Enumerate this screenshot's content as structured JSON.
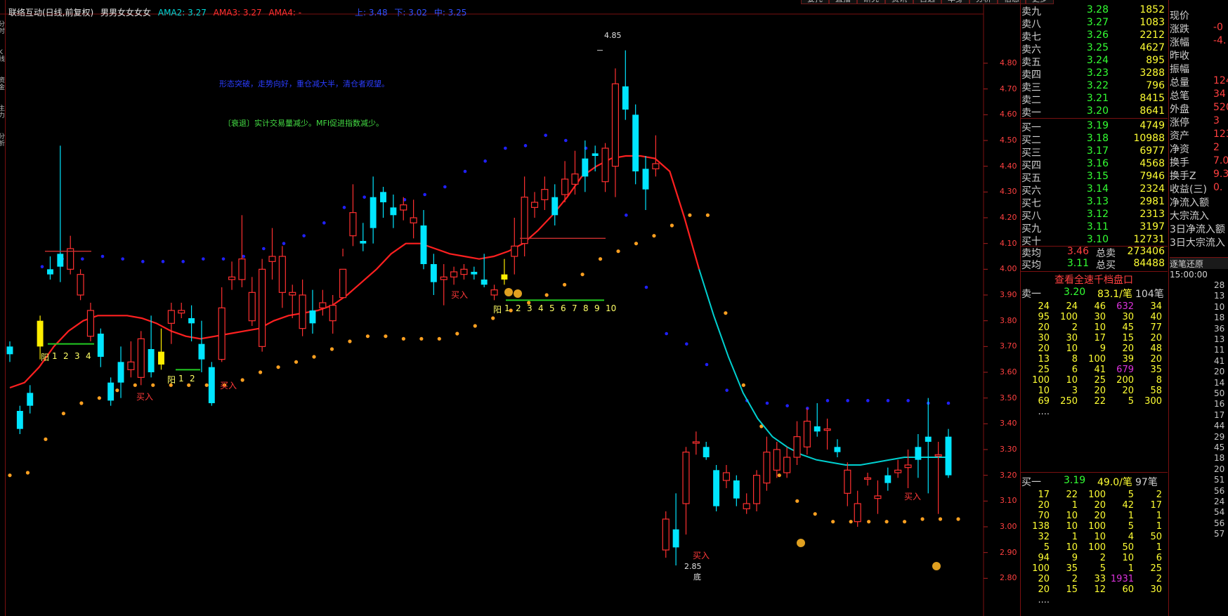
{
  "colors": {
    "up": "#ff3030",
    "down": "#00e5ff",
    "ma_red": "#ff2020",
    "ma_cyan": "#00d0d0",
    "dot_orange": "#ffa020",
    "dot_blue": "#2020ff",
    "yellow_bar": "#ffee00",
    "neutral": "#e0e0e0"
  },
  "menu": [
    "委托",
    "直播",
    "研究",
    "资讯",
    "自选",
    "本身",
    "分析",
    "信息",
    "更多"
  ],
  "header": {
    "stock_name": "联络互动(日线,前复权)",
    "indicator": "男男女女女女",
    "ama2": "AMA2: 3.27",
    "ama3": "AMA3: 3.27",
    "ama4": "AMA4: -",
    "up": "上: 3.48",
    "down": "下: 3.02",
    "mid": "中: 3.25"
  },
  "rail_labels": [
    "分时",
    "K线",
    "资金",
    "主力",
    "分析"
  ],
  "annotations": {
    "blue_text": "形态突破，走势向好，重仓减大半，清仓者观望。",
    "green_text": "〔衰退〕实计交易量减少。MFI促进指数减少。"
  },
  "price_axis": [
    "4.80",
    "4.70",
    "4.60",
    "4.50",
    "4.40",
    "4.30",
    "4.20",
    "4.10",
    "4.00",
    "3.90",
    "3.80",
    "3.70",
    "3.60",
    "3.50",
    "3.40",
    "3.30",
    "3.20",
    "3.10",
    "3.00",
    "2.90",
    "2.80"
  ],
  "chart_data": {
    "type": "candlestick",
    "ylim": [
      2.7,
      4.92
    ],
    "candles": [
      [
        3.7,
        3.67,
        3.72,
        3.64
      ],
      [
        3.45,
        3.38,
        3.47,
        3.36
      ],
      [
        3.52,
        3.47,
        3.55,
        3.44
      ],
      [
        3.8,
        3.7,
        3.82,
        3.65
      ],
      [
        4.0,
        3.98,
        4.05,
        3.96
      ],
      [
        4.06,
        4.01,
        4.48,
        3.95
      ],
      [
        4.0,
        4.08,
        4.13,
        3.98
      ],
      [
        3.9,
        3.98,
        4.0,
        3.88
      ],
      [
        3.74,
        3.84,
        3.87,
        3.72
      ],
      [
        3.75,
        3.66,
        3.77,
        3.62
      ],
      [
        3.56,
        3.49,
        3.58,
        3.47
      ],
      [
        3.64,
        3.56,
        3.7,
        3.5
      ],
      [
        3.61,
        3.64,
        3.72,
        3.58
      ],
      [
        3.58,
        3.73,
        3.76,
        3.55
      ],
      [
        3.69,
        3.6,
        3.82,
        3.58
      ],
      [
        3.68,
        3.63,
        3.77,
        3.61
      ],
      [
        3.79,
        3.84,
        3.87,
        3.71
      ],
      [
        3.83,
        3.84,
        3.87,
        3.81
      ],
      [
        3.81,
        3.79,
        3.86,
        3.72
      ],
      [
        3.71,
        3.65,
        3.8,
        3.6
      ],
      [
        3.62,
        3.48,
        3.64,
        3.47
      ],
      [
        3.65,
        3.85,
        3.93,
        3.64
      ],
      [
        3.96,
        3.97,
        4.03,
        3.92
      ],
      [
        3.96,
        4.04,
        4.21,
        3.93
      ],
      [
        3.8,
        3.91,
        3.97,
        3.78
      ],
      [
        3.7,
        4.0,
        4.04,
        3.68
      ],
      [
        4.03,
        4.05,
        4.16,
        3.96
      ],
      [
        3.91,
        4.05,
        4.09,
        3.85
      ],
      [
        3.9,
        3.91,
        3.94,
        3.81
      ],
      [
        3.77,
        3.9,
        3.96,
        3.74
      ],
      [
        3.84,
        3.79,
        3.92,
        3.75
      ],
      [
        3.85,
        3.87,
        3.92,
        3.82
      ],
      [
        3.8,
        3.86,
        3.9,
        3.75
      ],
      [
        3.89,
        4.0,
        4.08,
        4.05
      ],
      [
        4.13,
        4.22,
        4.33,
        4.09
      ],
      [
        4.11,
        4.1,
        4.18,
        4.07
      ],
      [
        4.28,
        4.16,
        4.36,
        4.1
      ],
      [
        4.3,
        4.26,
        4.32,
        4.2
      ],
      [
        4.24,
        4.21,
        4.29,
        4.16
      ],
      [
        4.23,
        4.25,
        4.28,
        4.19
      ],
      [
        4.18,
        4.2,
        4.27,
        4.12
      ],
      [
        4.17,
        4.02,
        4.23,
        4.0
      ],
      [
        4.02,
        3.95,
        4.06,
        3.9
      ],
      [
        3.96,
        3.97,
        4.02,
        3.86
      ],
      [
        3.97,
        3.99,
        4.01,
        3.94
      ],
      [
        3.98,
        4.0,
        4.02,
        3.96
      ],
      [
        3.99,
        3.98,
        4.01,
        3.96
      ],
      [
        3.96,
        3.94,
        4.06,
        3.93
      ],
      [
        3.9,
        3.92,
        3.94,
        3.88
      ],
      [
        3.98,
        3.96,
        4.04,
        3.94
      ],
      [
        4.05,
        4.09,
        4.2,
        3.98
      ],
      [
        4.1,
        4.28,
        4.36,
        4.05
      ],
      [
        4.24,
        4.26,
        4.3,
        4.2
      ],
      [
        4.27,
        4.31,
        4.36,
        4.23
      ],
      [
        4.28,
        4.21,
        4.33,
        4.17
      ],
      [
        4.29,
        4.35,
        4.42,
        4.26
      ],
      [
        4.33,
        4.37,
        4.46,
        4.29
      ],
      [
        4.43,
        4.36,
        4.5,
        4.3
      ],
      [
        4.45,
        4.44,
        4.48,
        4.38
      ],
      [
        4.34,
        4.47,
        4.49,
        4.3
      ],
      [
        4.4,
        4.72,
        4.78,
        4.28
      ],
      [
        4.71,
        4.62,
        4.85,
        4.58
      ],
      [
        4.6,
        4.38,
        4.64,
        4.33
      ],
      [
        4.39,
        4.31,
        4.44,
        4.23
      ],
      [
        4.39,
        4.41,
        4.52,
        4.36
      ],
      [
        2.91,
        3.03,
        3.06,
        2.88
      ],
      [
        2.99,
        2.92,
        3.13,
        2.85
      ],
      [
        3.09,
        3.29,
        3.31,
        2.97
      ],
      [
        3.33,
        3.33,
        3.37,
        3.28
      ],
      [
        3.31,
        3.27,
        3.33,
        3.26
      ],
      [
        3.22,
        3.08,
        3.24,
        3.06
      ],
      [
        3.18,
        3.21,
        3.24,
        3.15
      ],
      [
        3.18,
        3.11,
        3.2,
        3.08
      ],
      [
        3.07,
        3.09,
        3.13,
        3.05
      ],
      [
        3.09,
        3.2,
        3.22,
        3.06
      ],
      [
        3.17,
        3.29,
        3.35,
        3.14
      ],
      [
        3.22,
        3.3,
        3.33,
        3.19
      ],
      [
        3.21,
        3.27,
        3.31,
        3.19
      ],
      [
        3.27,
        3.35,
        3.41,
        3.24
      ],
      [
        3.31,
        3.41,
        3.46,
        3.28
      ],
      [
        3.39,
        3.37,
        3.48,
        3.35
      ],
      [
        3.38,
        3.38,
        3.42,
        3.3
      ],
      [
        3.31,
        3.29,
        3.34,
        3.27
      ],
      [
        3.13,
        3.22,
        3.25,
        3.08
      ],
      [
        3.02,
        3.09,
        3.14,
        3.0
      ],
      [
        3.19,
        3.19,
        3.21,
        3.16
      ],
      [
        3.11,
        3.12,
        3.18,
        3.05
      ],
      [
        3.2,
        3.17,
        3.23,
        3.14
      ],
      [
        3.21,
        3.22,
        3.26,
        3.19
      ],
      [
        3.23,
        3.24,
        3.3,
        3.15
      ],
      [
        3.31,
        3.26,
        3.36,
        3.19
      ],
      [
        3.35,
        3.33,
        3.5,
        3.13
      ],
      [
        3.28,
        3.28,
        3.33,
        3.05
      ],
      [
        3.35,
        3.2,
        3.38,
        3.19
      ]
    ],
    "ma_red": [
      3.54,
      3.56,
      3.62,
      3.7,
      3.76,
      3.8,
      3.82,
      3.82,
      3.82,
      3.81,
      3.79,
      3.76,
      3.74,
      3.73,
      3.74,
      3.75,
      3.76,
      3.77,
      3.8,
      3.82,
      3.83,
      3.84,
      3.86,
      3.9,
      3.95,
      4.0,
      4.06,
      4.1,
      4.1,
      4.08,
      4.06,
      4.05,
      4.04,
      4.05,
      4.07,
      4.1,
      4.15,
      4.21,
      4.28,
      4.36,
      4.4,
      4.43,
      4.44,
      4.44,
      4.43,
      4.38,
      4.2,
      4.0,
      3.82,
      3.66,
      3.52,
      3.42,
      3.35,
      3.31,
      3.28,
      3.26,
      3.25,
      3.24,
      3.24,
      3.25,
      3.26,
      3.27,
      3.27,
      3.27,
      3.27
    ],
    "ma_cyan_range": [
      47,
      64
    ],
    "up_dots": [
      3.2,
      3.21,
      3.34,
      3.44,
      3.48,
      3.5,
      3.53,
      3.55,
      3.55,
      3.55,
      3.55,
      3.55,
      3.55,
      3.57,
      3.6,
      3.62,
      3.64,
      3.66,
      3.69,
      3.72,
      3.74,
      3.74,
      3.73,
      3.73,
      3.73,
      3.75,
      3.78,
      3.81,
      3.84,
      3.87,
      3.9,
      3.94,
      3.98,
      4.04,
      4.07,
      4.1,
      4.13,
      4.17,
      4.21,
      4.21,
      3.83,
      3.55,
      3.39,
      3.2,
      3.1,
      3.05,
      3.02,
      3.02,
      3.02,
      3.02,
      3.02,
      3.03,
      3.03,
      3.03
    ],
    "down_dots": [
      4.01,
      4.04,
      4.04,
      4.05,
      4.04,
      4.03,
      4.03,
      4.03,
      4.04,
      4.04,
      4.05,
      4.08,
      4.1,
      4.13,
      4.18,
      4.24,
      4.28,
      4.28,
      4.27,
      4.29,
      4.32,
      4.38,
      4.42,
      4.47,
      4.48,
      4.52,
      4.5,
      4.47,
      4.4,
      4.21,
      3.93,
      3.75,
      3.71,
      3.63,
      3.53,
      3.49,
      3.48,
      3.47,
      3.46,
      3.49,
      3.49,
      3.49,
      3.49,
      3.49,
      3.48,
      3.48
    ],
    "labels": {
      "high": "4.85",
      "low": "2.85",
      "bottom": "底"
    }
  },
  "signals": {
    "buy": "买入",
    "yang": "阳"
  },
  "yang_seqs": [
    {
      "nums": [
        "1",
        "2",
        "3",
        "4"
      ]
    },
    {
      "nums": [
        "1",
        "2"
      ]
    },
    {
      "nums": [
        "1",
        "2",
        "3",
        "4",
        "5",
        "6",
        "7",
        "8",
        "9",
        "10"
      ]
    }
  ],
  "orderbook": {
    "asks": [
      {
        "label": "卖九",
        "price": "3.28",
        "vol": "1852"
      },
      {
        "label": "卖八",
        "price": "3.27",
        "vol": "1083"
      },
      {
        "label": "卖七",
        "price": "3.26",
        "vol": "2212"
      },
      {
        "label": "卖六",
        "price": "3.25",
        "vol": "4627"
      },
      {
        "label": "卖五",
        "price": "3.24",
        "vol": "895"
      },
      {
        "label": "卖四",
        "price": "3.23",
        "vol": "3288"
      },
      {
        "label": "卖三",
        "price": "3.22",
        "vol": "796"
      },
      {
        "label": "卖二",
        "price": "3.21",
        "vol": "8415"
      },
      {
        "label": "卖一",
        "price": "3.20",
        "vol": "8641"
      }
    ],
    "bids": [
      {
        "label": "买一",
        "price": "3.19",
        "vol": "4749"
      },
      {
        "label": "买二",
        "price": "3.18",
        "vol": "10988"
      },
      {
        "label": "买三",
        "price": "3.17",
        "vol": "6977"
      },
      {
        "label": "买四",
        "price": "3.16",
        "vol": "4568"
      },
      {
        "label": "买五",
        "price": "3.15",
        "vol": "7946"
      },
      {
        "label": "买六",
        "price": "3.14",
        "vol": "2324"
      },
      {
        "label": "买七",
        "price": "3.13",
        "vol": "2981"
      },
      {
        "label": "买八",
        "price": "3.12",
        "vol": "2313"
      },
      {
        "label": "买九",
        "price": "3.11",
        "vol": "3197"
      },
      {
        "label": "买十",
        "price": "3.10",
        "vol": "12731"
      }
    ],
    "avg_sell": {
      "label": "卖均",
      "price": "3.46",
      "tlabel": "总卖",
      "total": "273406"
    },
    "avg_buy": {
      "label": "买均",
      "price": "3.11",
      "tlabel": "总买",
      "total": "84488"
    },
    "deep_btn": "查看全速千档盘口",
    "sell_queue": {
      "label": "卖一",
      "price": "3.20",
      "per": "83.1/笔",
      "count": "104笔",
      "rows": [
        [
          "24",
          "24",
          "46",
          "632",
          "34"
        ],
        [
          "95",
          "100",
          "30",
          "30",
          "40"
        ],
        [
          "20",
          "2",
          "10",
          "45",
          "77"
        ],
        [
          "30",
          "30",
          "17",
          "15",
          "20"
        ],
        [
          "20",
          "10",
          "9",
          "20",
          "48"
        ],
        [
          "13",
          "8",
          "100",
          "39",
          "20"
        ],
        [
          "25",
          "6",
          "41",
          "679",
          "35"
        ],
        [
          "100",
          "10",
          "25",
          "200",
          "8"
        ],
        [
          "10",
          "3",
          "20",
          "20",
          "58"
        ],
        [
          "69",
          "250",
          "22",
          "5",
          "300"
        ],
        [
          "....",
          "",
          "",
          "",
          ""
        ]
      ]
    },
    "buy_queue": {
      "label": "买一",
      "price": "3.19",
      "per": "49.0/笔",
      "count": "97笔",
      "rows": [
        [
          "17",
          "22",
          "100",
          "5",
          "2"
        ],
        [
          "20",
          "1",
          "20",
          "42",
          "17"
        ],
        [
          "70",
          "10",
          "20",
          "1",
          "1"
        ],
        [
          "138",
          "10",
          "100",
          "5",
          "1"
        ],
        [
          "32",
          "1",
          "10",
          "4",
          "50"
        ],
        [
          "5",
          "10",
          "100",
          "50",
          "1"
        ],
        [
          "94",
          "9",
          "2",
          "10",
          "6"
        ],
        [
          "100",
          "35",
          "5",
          "1",
          "25"
        ],
        [
          "20",
          "2",
          "33",
          "1931",
          "2"
        ],
        [
          "20",
          "15",
          "12",
          "60",
          "30"
        ],
        [
          "....",
          "",
          "",
          "",
          ""
        ]
      ]
    }
  },
  "quote": {
    "rows": [
      {
        "label": "现价",
        "val": ""
      },
      {
        "label": "涨跌",
        "val": "-0"
      },
      {
        "label": "涨幅",
        "val": "-4."
      },
      {
        "label": "昨收",
        "val": ""
      },
      {
        "label": "振幅",
        "val": ""
      },
      {
        "label": "总量",
        "val": "124."
      },
      {
        "label": "总笔",
        "val": "34"
      },
      {
        "label": "外盘",
        "val": "520"
      },
      {
        "label": "涨停",
        "val": "3"
      },
      {
        "label": "资产",
        "val": "123."
      },
      {
        "label": "净资",
        "val": "2"
      },
      {
        "label": "换手",
        "val": "7.0"
      },
      {
        "label": "换手Z",
        "val": "9.3"
      },
      {
        "label": "收益(三)",
        "val": "0."
      },
      {
        "label": "净流入额",
        "val": ""
      },
      {
        "label": "大宗流入",
        "val": ""
      },
      {
        "label": "3日净流入额",
        "val": ""
      },
      {
        "label": "3日大宗流入",
        "val": ""
      }
    ],
    "trade_title": "逐笔还原",
    "trade_time": "15:00:00",
    "ticks": [
      "28",
      "13",
      "10",
      "18",
      "36",
      "13",
      "11",
      "41",
      "20",
      "14",
      "50",
      "16",
      "17",
      "44",
      "29",
      "45",
      "18",
      "20",
      "51",
      "56",
      "24",
      "54",
      "56",
      "57"
    ]
  }
}
